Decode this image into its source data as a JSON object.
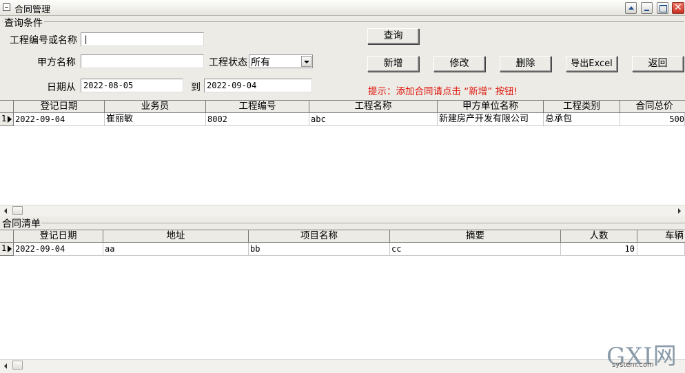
{
  "window": {
    "title": "合同管理"
  },
  "query": {
    "group_label": "查询条件",
    "code_or_name_label": "工程编号或名称",
    "code_or_name_value": "|",
    "party_a_label": "甲方名称",
    "party_a_value": "",
    "status_label": "工程状态",
    "status_value": "所有",
    "date_from_label": "日期从",
    "date_from_value": "2022-08-05",
    "date_to_label": "到",
    "date_to_value": "2022-09-04"
  },
  "buttons": {
    "search": "查询",
    "add": "新增",
    "edit": "修改",
    "delete": "删除",
    "export": "导出Excel",
    "back": "返回"
  },
  "hint": "提示：添加合同请点击 “新增” 按钮!",
  "contracts_table": {
    "columns": [
      "登记日期",
      "业务员",
      "工程编号",
      "工程名称",
      "甲方单位名称",
      "工程类别",
      "合同总价"
    ],
    "rows": [
      {
        "row_no": "1",
        "cells": [
          "2022-09-04",
          "崔丽敏",
          "8002",
          "abc",
          "新建房产开发有限公司",
          "总承包",
          "500"
        ]
      }
    ]
  },
  "detail_section": {
    "label": "合同清单"
  },
  "detail_table": {
    "columns": [
      "登记日期",
      "地址",
      "项目名称",
      "摘要",
      "人数",
      "车辆"
    ],
    "rows": [
      {
        "row_no": "1",
        "cells": [
          "2022-09-04",
          "aa",
          "bb",
          "cc",
          "10",
          ""
        ]
      }
    ]
  },
  "watermark": {
    "brand": "GXI网",
    "domain": "system.com"
  },
  "colors": {
    "hint": "#e0140a",
    "window_bg": "#ecebe6"
  }
}
